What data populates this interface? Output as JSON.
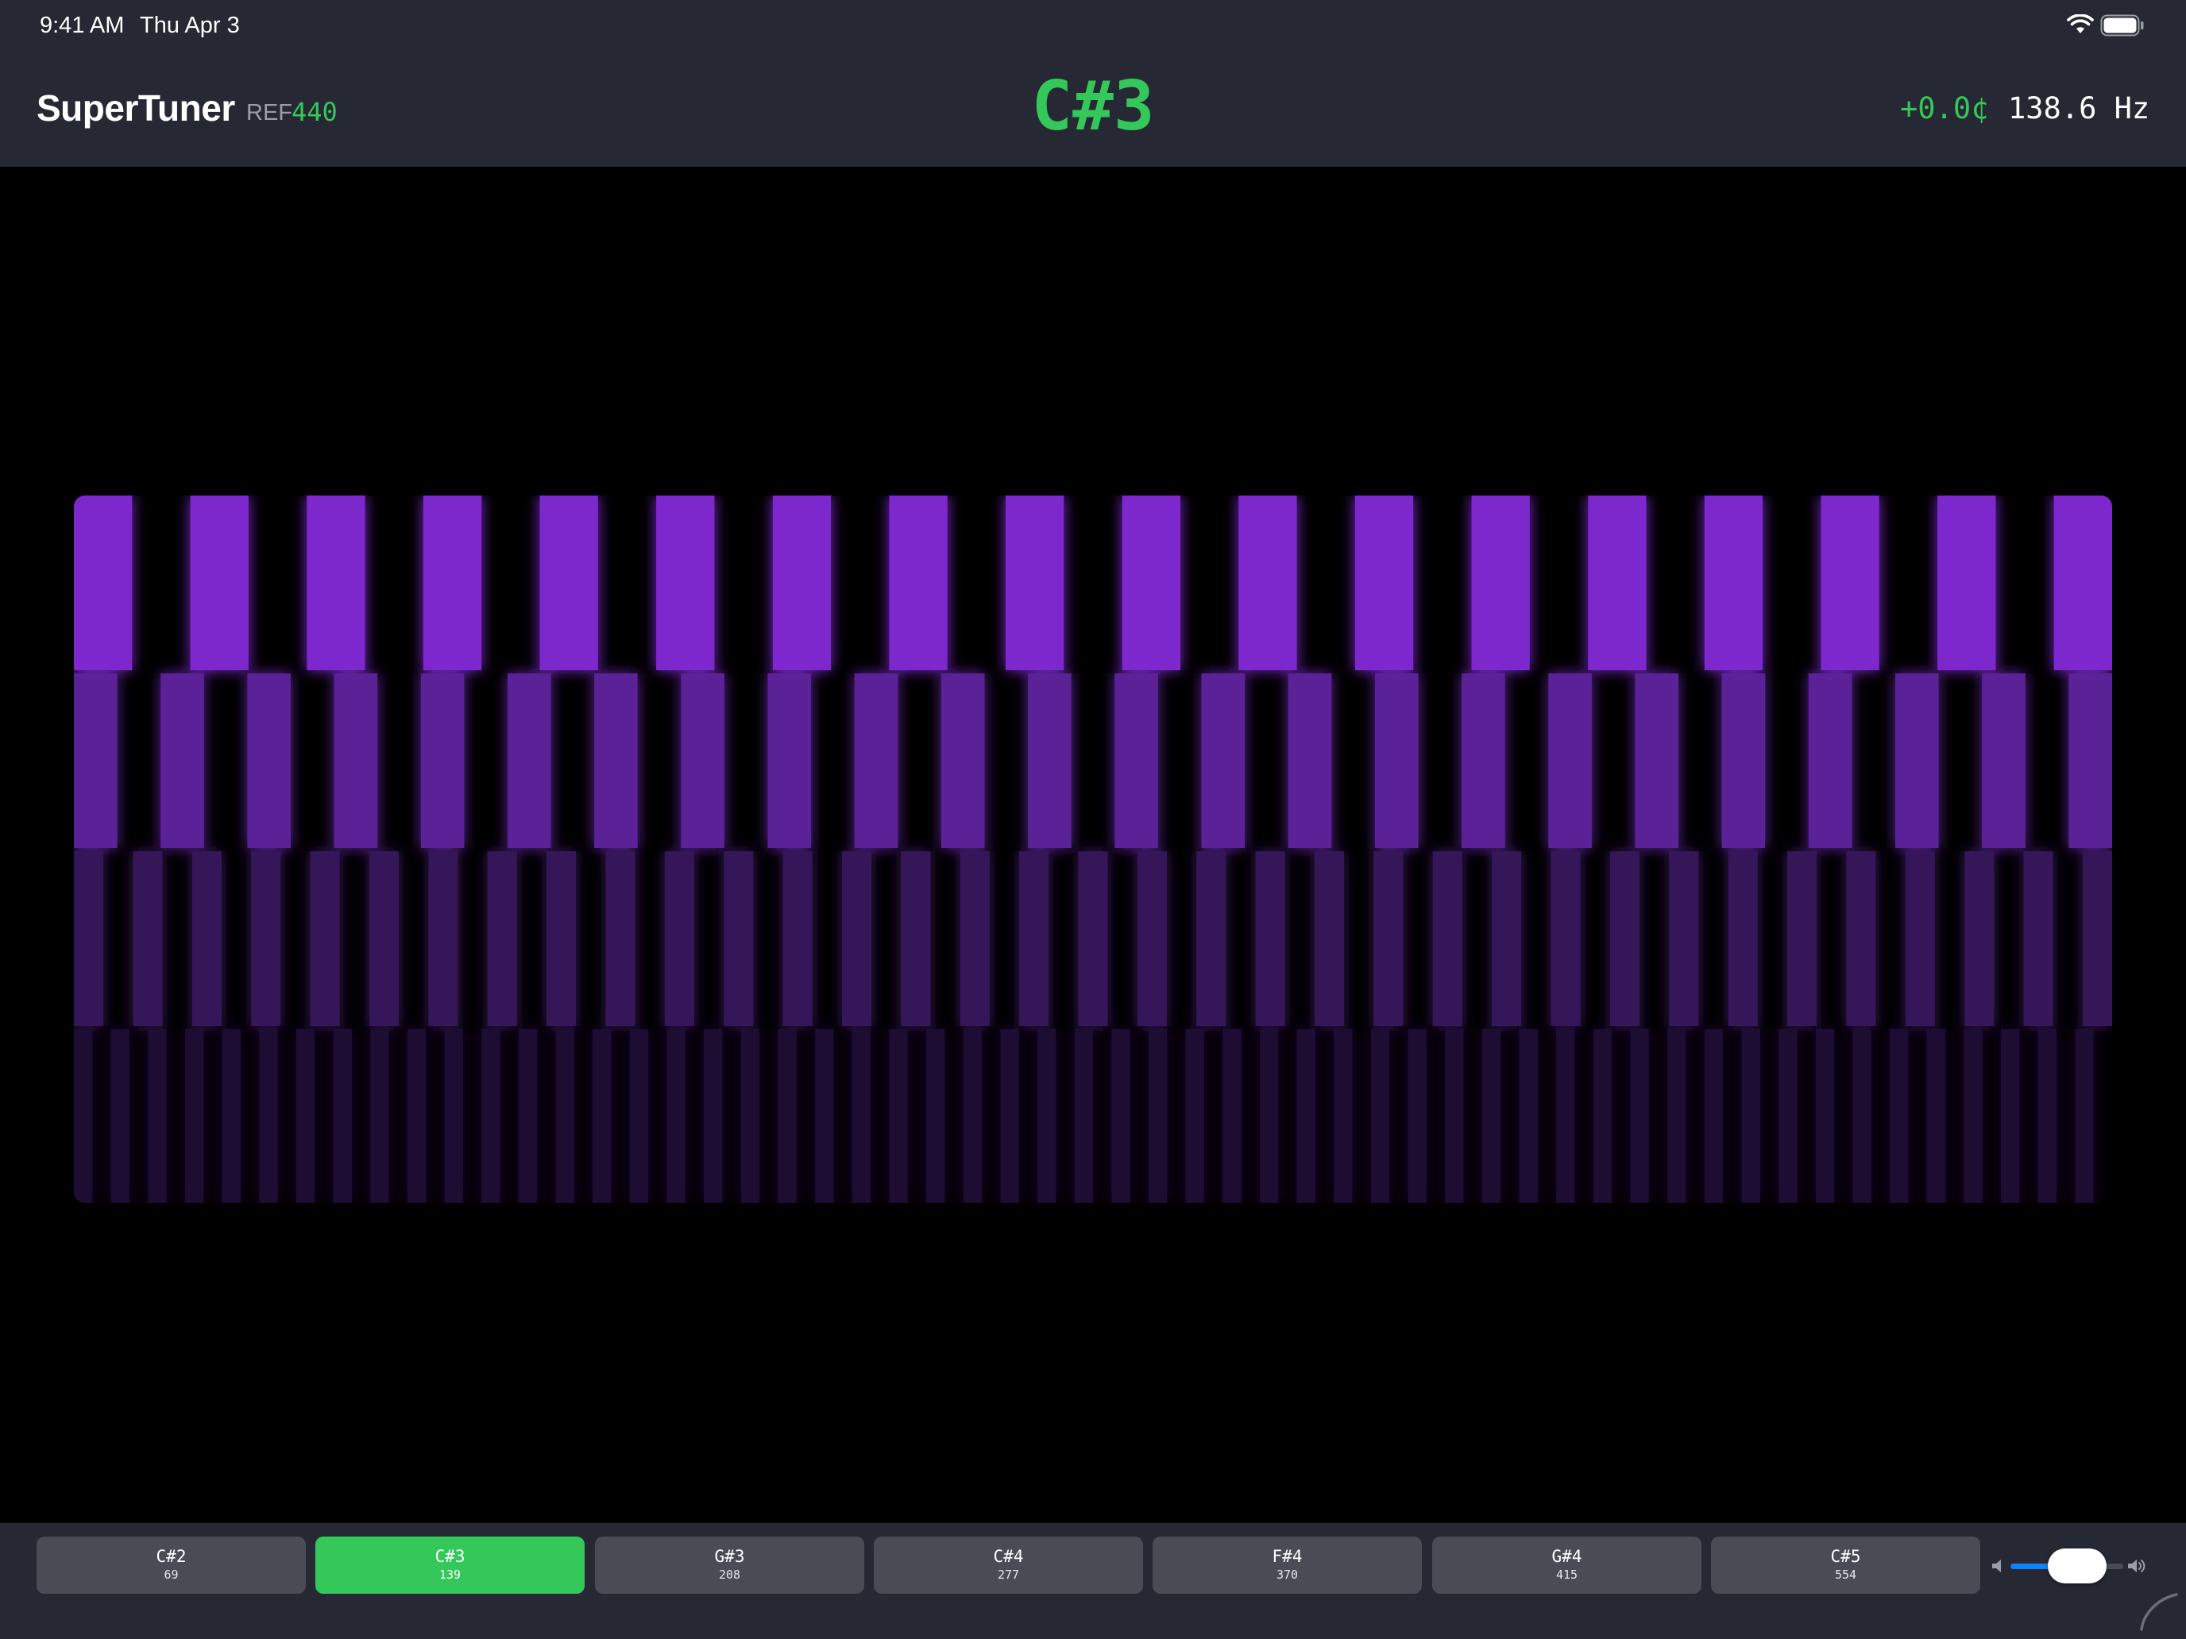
{
  "status_bar": {
    "time": "9:41 AM",
    "date": "Thu Apr 3",
    "wifi_icon": "wifi-icon",
    "battery_icon": "battery-icon"
  },
  "header": {
    "title": "SuperTuner",
    "ref_label": "REF",
    "ref_value": "440",
    "note": "C#3",
    "cents": "+0.0¢",
    "frequency": "138.6 Hz"
  },
  "colors": {
    "accent_green": "#34c759",
    "bar_bg": "#262833",
    "button_bg": "#4a4b55",
    "visualizer_rows": [
      "#7c28cc",
      "#5b2298",
      "#351659",
      "#1e0d33"
    ]
  },
  "visualizer": {
    "rows": [
      {
        "tiles": 17.5
      },
      {
        "tiles": 23.5
      },
      {
        "tiles": 34.5
      },
      {
        "tiles": 55
      }
    ]
  },
  "note_buttons": [
    {
      "label": "C#2",
      "freq": "69",
      "active": false
    },
    {
      "label": "C#3",
      "freq": "139",
      "active": true
    },
    {
      "label": "G#3",
      "freq": "208",
      "active": false
    },
    {
      "label": "C#4",
      "freq": "277",
      "active": false
    },
    {
      "label": "F#4",
      "freq": "370",
      "active": false
    },
    {
      "label": "G#4",
      "freq": "415",
      "active": false
    },
    {
      "label": "C#5",
      "freq": "554",
      "active": false
    }
  ],
  "volume": {
    "level": 0.33,
    "low_icon": "speaker-low-icon",
    "high_icon": "speaker-high-icon"
  }
}
